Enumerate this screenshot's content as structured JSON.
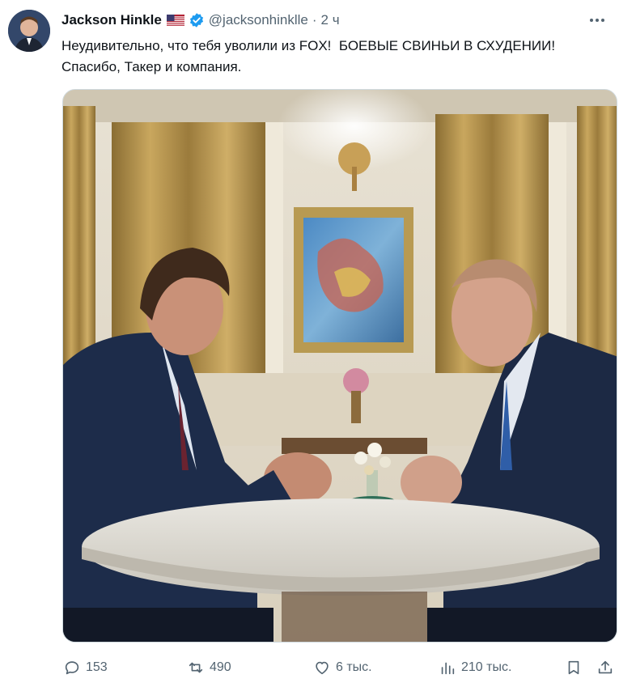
{
  "author": {
    "name": "Jackson Hinkle",
    "handle": "@jacksonhinklle",
    "separator": "·",
    "time": "2 ч",
    "flag_icon": "us-flag-icon",
    "verified_icon": "verified-badge-icon",
    "verified_color": "#1d9bf0"
  },
  "tweet": {
    "text": "Неудивительно, что тебя уволили из FOX!  БОЕВЫЕ СВИНЬИ В СХУДЕНИИ!\nСпасибо, Такер и компания."
  },
  "actions": {
    "replies": "153",
    "reposts": "490",
    "likes": "6 тыс.",
    "views": "210 тыс."
  },
  "colors": {
    "text": "#0f1419",
    "secondary": "#536471"
  }
}
